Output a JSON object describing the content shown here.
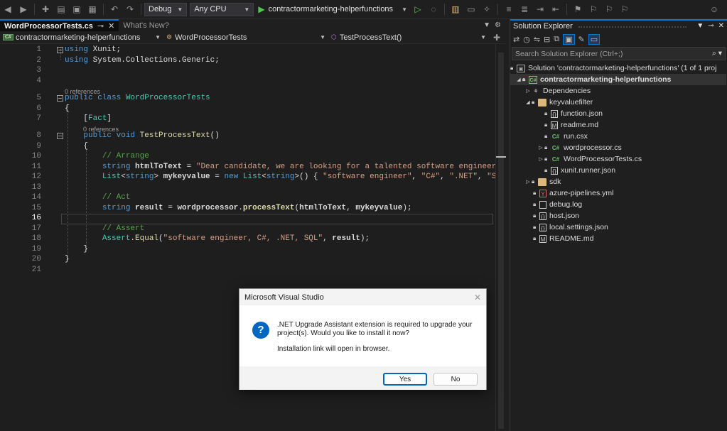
{
  "toolbar": {
    "config": "Debug",
    "platform": "Any CPU",
    "startup_project": "contractormarketing-helperfunctions"
  },
  "tabs": [
    {
      "label": "WordProcessorTests.cs"
    },
    {
      "label": "What's New?"
    }
  ],
  "navbar": {
    "project": "contractormarketing-helperfunctions",
    "class": "WordProcessorTests",
    "member": "TestProcessText()"
  },
  "editor": {
    "current_line": 16,
    "references_label": "0 references"
  },
  "solution_explorer": {
    "title": "Solution Explorer",
    "search_placeholder": "Search Solution Explorer (Ctrl+;)",
    "solution": "Solution 'contractormarketing-helperfunctions' (1 of 1 proj",
    "project": "contractormarketing-helperfunctions",
    "items": [
      {
        "label": "Dependencies"
      },
      {
        "label": "keyvaluefilter"
      },
      {
        "label": "function.json"
      },
      {
        "label": "readme.md"
      },
      {
        "label": "run.csx"
      },
      {
        "label": "wordprocessor.cs"
      },
      {
        "label": "WordProcessorTests.cs"
      },
      {
        "label": "xunit.runner.json"
      },
      {
        "label": "sdk"
      },
      {
        "label": "azure-pipelines.yml"
      },
      {
        "label": "debug.log"
      },
      {
        "label": "host.json"
      },
      {
        "label": "local.settings.json"
      },
      {
        "label": "README.md"
      }
    ]
  },
  "dialog": {
    "title": "Microsoft Visual Studio",
    "message": ".NET Upgrade Assistant extension is required to upgrade your project(s). Would you like to install it now?",
    "note": "Installation link will open in browser.",
    "yes_label": "Yes",
    "no_label": "No"
  }
}
